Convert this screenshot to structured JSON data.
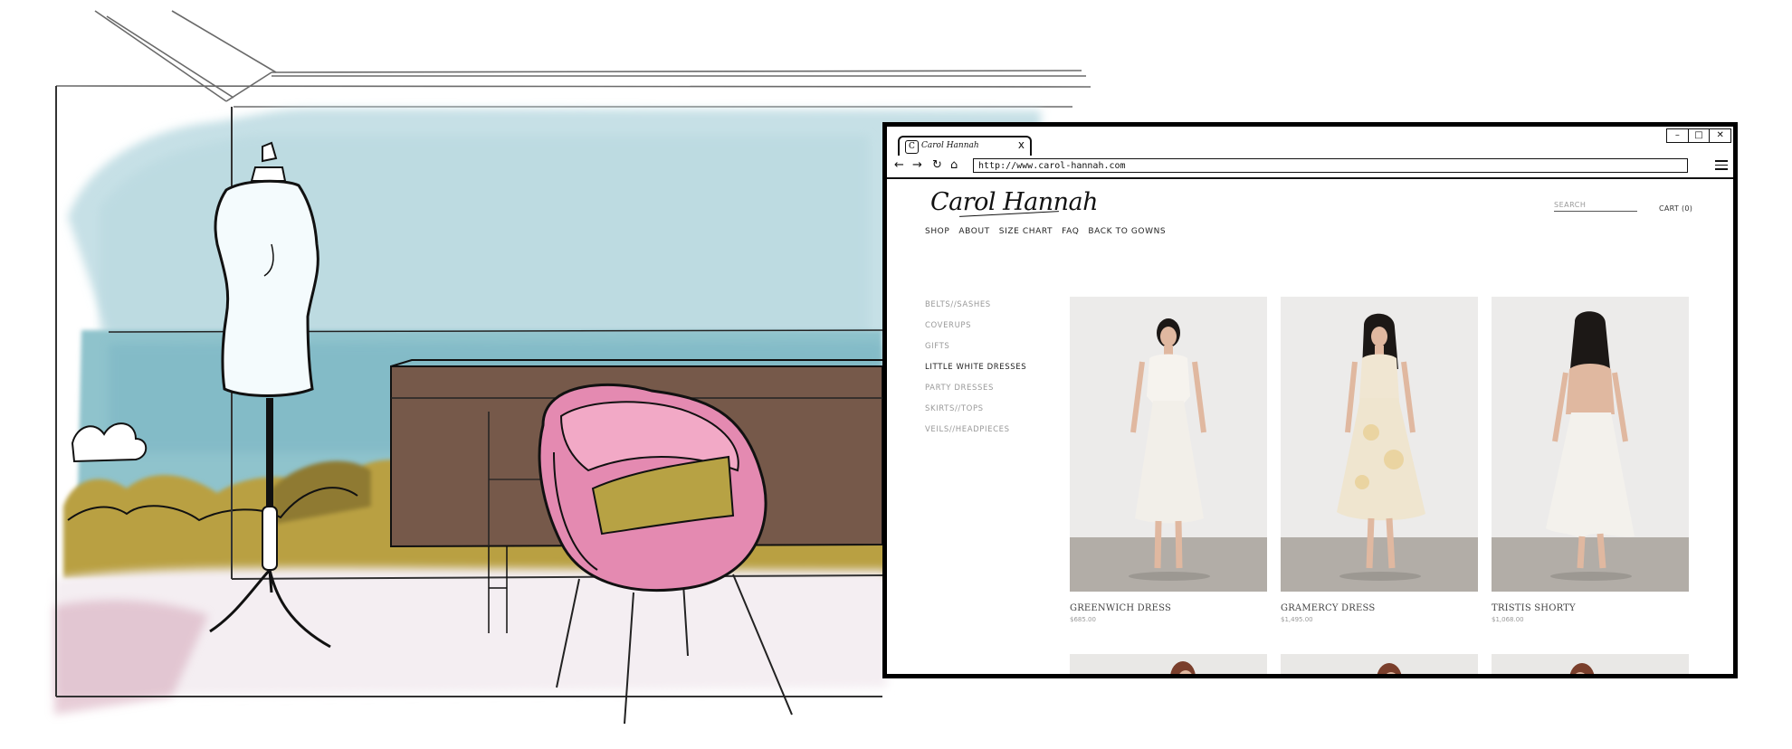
{
  "browser": {
    "tab_title": "Carol Hannah",
    "tab_favicon": "C",
    "tab_close": "x",
    "url": "http://www.carol-hannah.com",
    "window_controls": [
      "–",
      "□",
      "✕"
    ],
    "nav_icons": [
      "back-arrow-icon",
      "forward-arrow-icon",
      "reload-icon",
      "home-icon",
      "menu-icon"
    ]
  },
  "site": {
    "logo": "Carol Hannah",
    "search_placeholder": "SEARCH",
    "cart": "CART (0)",
    "nav": [
      "SHOP",
      "ABOUT",
      "SIZE CHART",
      "FAQ",
      "BACK TO GOWNS"
    ],
    "categories": [
      {
        "label": "BELTS//SASHES",
        "active": false
      },
      {
        "label": "COVERUPS",
        "active": false
      },
      {
        "label": "GIFTS",
        "active": false
      },
      {
        "label": "LITTLE WHITE DRESSES",
        "active": true
      },
      {
        "label": "PARTY DRESSES",
        "active": false
      },
      {
        "label": "SKIRTS//TOPS",
        "active": false
      },
      {
        "label": "VEILS//HEADPIECES",
        "active": false
      }
    ],
    "products": [
      {
        "name": "GREENWICH DRESS",
        "price": "$685.00"
      },
      {
        "name": "GRAMERCY DRESS",
        "price": "$1,495.00"
      },
      {
        "name": "TRISTIS SHORTY",
        "price": "$1,068.00"
      }
    ]
  },
  "colors": {
    "sky_wash": "#bcdde2",
    "sea": "#8ec1cc",
    "cabinet": "#7a5c4c",
    "chair_pink": "#e58ab1",
    "cushion": "#b8a444",
    "bushes": "#b6992c"
  }
}
